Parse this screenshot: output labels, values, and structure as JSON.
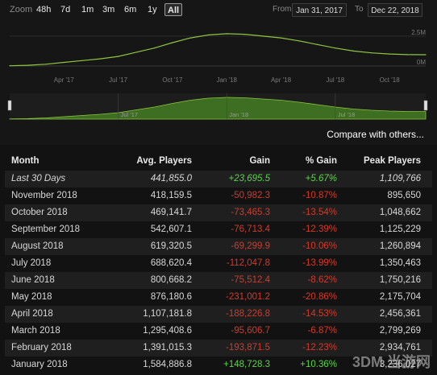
{
  "zoom": {
    "label": "Zoom",
    "buttons": [
      "48h",
      "7d",
      "1m",
      "3m",
      "6m",
      "1y",
      "All"
    ],
    "active": "All"
  },
  "range": {
    "from_label": "From",
    "from_value": "Jan 31, 2017",
    "to_label": "To",
    "to_value": "Dec 22, 2018"
  },
  "chart_data": {
    "type": "area",
    "title": "",
    "xlabel": "",
    "ylabel": "",
    "x_tick_labels": [
      "Apr '17",
      "Jul '17",
      "Oct '17",
      "Jan '18",
      "Apr '18",
      "Jul '18",
      "Oct '18"
    ],
    "y_tick_labels": [
      "2.5M",
      "0M"
    ],
    "ylim": [
      0,
      3500000
    ],
    "series": [
      {
        "x": [
          "2017-01",
          "2017-02",
          "2017-03",
          "2017-04",
          "2017-05",
          "2017-06",
          "2017-07",
          "2017-08",
          "2017-09",
          "2017-10",
          "2017-11",
          "2017-12",
          "2018-01",
          "2018-02",
          "2018-03",
          "2018-04",
          "2018-05",
          "2018-06",
          "2018-07",
          "2018-08",
          "2018-09",
          "2018-10",
          "2018-11",
          "2018-12"
        ],
        "values": [
          20000,
          60000,
          150000,
          300000,
          450000,
          600000,
          800000,
          1150000,
          1500000,
          1950000,
          2350000,
          2600000,
          2700000,
          2650000,
          2500000,
          2350000,
          2100000,
          1800000,
          1500000,
          1250000,
          1100000,
          1000000,
          950000,
          940000
        ]
      }
    ],
    "navigator_tick_labels": [
      "Jul '17",
      "Jan '18",
      "Jul '18"
    ]
  },
  "compare_link": "Compare with others...",
  "table": {
    "headers": [
      "Month",
      "Avg. Players",
      "Gain",
      "% Gain",
      "Peak Players"
    ],
    "rows": [
      [
        "Last 30 Days",
        "441,855.0",
        "+23,695.5",
        "+5.67%",
        "1,109,766"
      ],
      [
        "November 2018",
        "418,159.5",
        "-50,982.3",
        "-10.87%",
        "895,650"
      ],
      [
        "October 2018",
        "469,141.7",
        "-73,465.3",
        "-13.54%",
        "1,048,662"
      ],
      [
        "September 2018",
        "542,607.1",
        "-76,713.4",
        "-12.39%",
        "1,125,229"
      ],
      [
        "August 2018",
        "619,320.5",
        "-69,299.9",
        "-10.06%",
        "1,260,894"
      ],
      [
        "July 2018",
        "688,620.4",
        "-112,047.8",
        "-13.99%",
        "1,350,463"
      ],
      [
        "June 2018",
        "800,668.2",
        "-75,512.4",
        "-8.62%",
        "1,750,216"
      ],
      [
        "May 2018",
        "876,180.6",
        "-231,001.2",
        "-20.86%",
        "2,175,704"
      ],
      [
        "April 2018",
        "1,107,181.8",
        "-188,226.8",
        "-14.53%",
        "2,456,361"
      ],
      [
        "March 2018",
        "1,295,408.6",
        "-95,606.7",
        "-6.87%",
        "2,799,269"
      ],
      [
        "February 2018",
        "1,391,015.3",
        "-193,871.5",
        "-12.23%",
        "2,934,761"
      ],
      [
        "January 2018",
        "1,584,886.8",
        "+148,728.3",
        "+10.36%",
        "3,236,027"
      ]
    ]
  },
  "watermark": "3DM 当游网",
  "colors": {
    "line": "#8ec63f",
    "fill": "#3d6e22",
    "positive": "#5bd34a",
    "negative": "#d23a2a"
  }
}
